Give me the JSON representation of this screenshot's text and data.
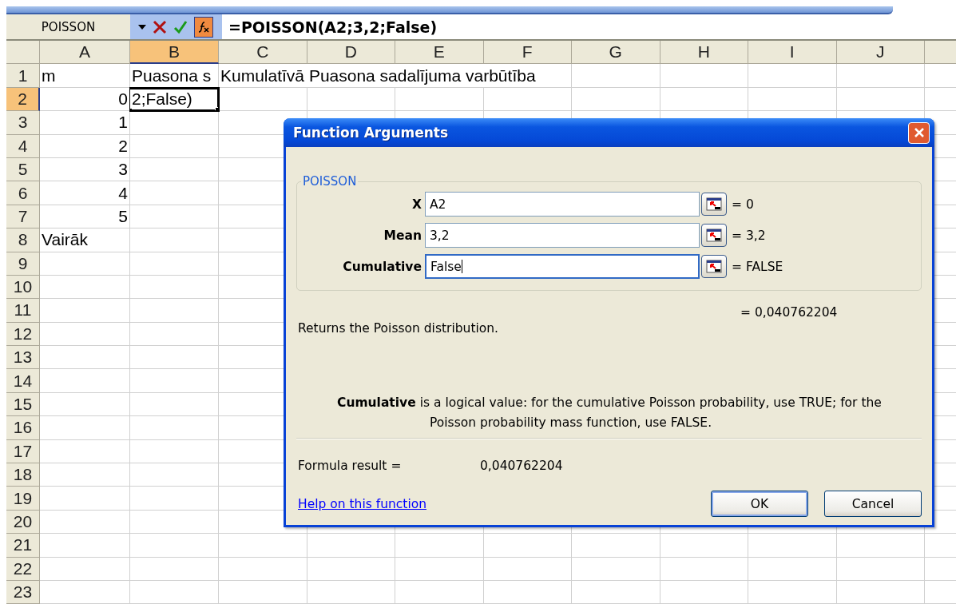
{
  "name_box": "POISSON",
  "formula": "=POISSON(A2;3,2;False)",
  "columns": [
    {
      "label": "A",
      "selected": false
    },
    {
      "label": "B",
      "selected": true
    },
    {
      "label": "C",
      "selected": false
    },
    {
      "label": "D",
      "selected": false
    },
    {
      "label": "E",
      "selected": false
    },
    {
      "label": "F",
      "selected": false
    },
    {
      "label": "G",
      "selected": false
    },
    {
      "label": "H",
      "selected": false
    },
    {
      "label": "I",
      "selected": false
    },
    {
      "label": "J",
      "selected": false
    }
  ],
  "rows": [
    {
      "label": "1",
      "selected": false,
      "cells": [
        {
          "kind": "text",
          "text": "m"
        },
        {
          "kind": "text",
          "text": "Puasona s"
        },
        {
          "kind": "text",
          "text": "Kumulatīvā Puasona sadalījuma varbūtība"
        }
      ]
    },
    {
      "label": "2",
      "selected": true,
      "cells": [
        {
          "kind": "number",
          "text": "0"
        },
        {
          "kind": "text",
          "text": "2;False)"
        }
      ]
    },
    {
      "label": "3",
      "selected": false,
      "cells": [
        {
          "kind": "number",
          "text": "1"
        }
      ]
    },
    {
      "label": "4",
      "selected": false,
      "cells": [
        {
          "kind": "number",
          "text": "2"
        }
      ]
    },
    {
      "label": "5",
      "selected": false,
      "cells": [
        {
          "kind": "number",
          "text": "3"
        }
      ]
    },
    {
      "label": "6",
      "selected": false,
      "cells": [
        {
          "kind": "number",
          "text": "4"
        }
      ]
    },
    {
      "label": "7",
      "selected": false,
      "cells": [
        {
          "kind": "number",
          "text": "5"
        }
      ]
    },
    {
      "label": "8",
      "selected": false,
      "cells": [
        {
          "kind": "text",
          "text": "Vairāk"
        }
      ]
    },
    {
      "label": "9",
      "selected": false
    },
    {
      "label": "10",
      "selected": false
    },
    {
      "label": "11",
      "selected": false
    },
    {
      "label": "12",
      "selected": false
    },
    {
      "label": "13",
      "selected": false
    },
    {
      "label": "14",
      "selected": false
    },
    {
      "label": "15",
      "selected": false
    },
    {
      "label": "16",
      "selected": false
    },
    {
      "label": "17",
      "selected": false
    },
    {
      "label": "18",
      "selected": false
    },
    {
      "label": "19",
      "selected": false
    },
    {
      "label": "20",
      "selected": false
    },
    {
      "label": "21",
      "selected": false
    },
    {
      "label": "22",
      "selected": false
    },
    {
      "label": "23",
      "selected": false
    }
  ],
  "dialog": {
    "title": "Function Arguments",
    "group": "POISSON",
    "arguments": [
      {
        "label": "X",
        "value": "A2",
        "result": "= 0",
        "focused": false
      },
      {
        "label": "Mean",
        "value": "3,2",
        "result": "= 3,2",
        "focused": false
      },
      {
        "label": "Cumulative",
        "value": "False",
        "result": "= FALSE",
        "focused": true
      }
    ],
    "result": "= 0,040762204",
    "description": "Returns the Poisson distribution.",
    "argument_help": "**Cumulative** is a logical value: for the cumulative Poisson probability, use TRUE; for the Poisson probability mass function, use FALSE.",
    "formula_result_label": "Formula result =",
    "formula_result": "0,040762204",
    "help_link": "Help on this function",
    "buttons": [
      {
        "label": "OK",
        "default": true
      },
      {
        "label": "Cancel",
        "default": false
      }
    ]
  }
}
